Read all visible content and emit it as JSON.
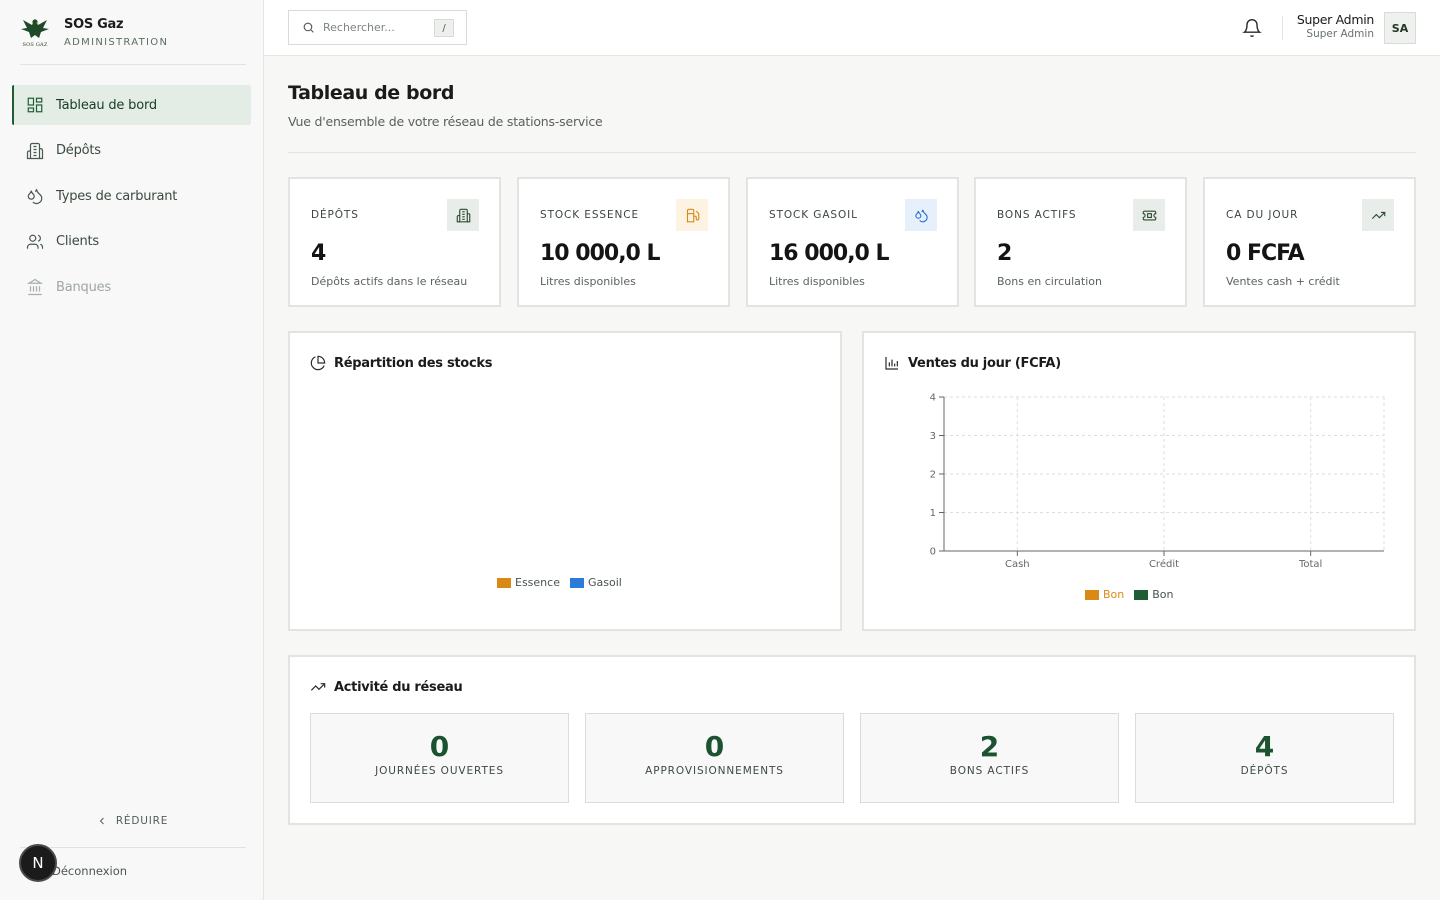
{
  "sidebar": {
    "brand_name": "SOS Gaz",
    "brand_subtitle": "ADMINISTRATION",
    "logo_caption": "SOS GAZ",
    "items": [
      {
        "label": "Tableau de bord",
        "icon": "dashboard-icon",
        "active": true
      },
      {
        "label": "Dépôts",
        "icon": "building-icon"
      },
      {
        "label": "Types de carburant",
        "icon": "droplets-icon"
      },
      {
        "label": "Clients",
        "icon": "users-icon"
      },
      {
        "label": "Banques",
        "icon": "bank-icon",
        "disabled": true
      }
    ],
    "reduce_label": "RÉDUIRE",
    "logout_label": "Déconnexion",
    "badge_letter": "N"
  },
  "header": {
    "search_placeholder": "Rechercher...",
    "search_shortcut": "/",
    "user_name": "Super Admin",
    "user_role": "Super Admin",
    "avatar_initials": "SA"
  },
  "page": {
    "title": "Tableau de bord",
    "subtitle": "Vue d'ensemble de votre réseau de stations-service"
  },
  "stats": [
    {
      "label": "DÉPÔTS",
      "value": "4",
      "desc": "Dépôts actifs dans le réseau",
      "icon": "building-icon",
      "icon_bg": "#e9edea",
      "icon_color": "#2d4a35"
    },
    {
      "label": "STOCK ESSENCE",
      "value": "10 000,0 L",
      "desc": "Litres disponibles",
      "icon": "fuel-pump-icon",
      "icon_bg": "#fdf3e3",
      "icon_color": "#d98a16"
    },
    {
      "label": "STOCK GASOIL",
      "value": "16 000,0 L",
      "desc": "Litres disponibles",
      "icon": "droplets-icon",
      "icon_bg": "#e6f0fb",
      "icon_color": "#2b6fcf"
    },
    {
      "label": "BONS ACTIFS",
      "value": "2",
      "desc": "Bons en circulation",
      "icon": "ticket-icon",
      "icon_bg": "#e9edea",
      "icon_color": "#2d4a35"
    },
    {
      "label": "CA DU JOUR",
      "value": "0 FCFA",
      "desc": "Ventes cash + crédit",
      "icon": "trending-up-icon",
      "icon_bg": "#e9edea",
      "icon_color": "#2d4a35"
    }
  ],
  "stock_chart": {
    "title": "Répartition des stocks",
    "legend": [
      {
        "name": "Essence",
        "color": "#d98a16"
      },
      {
        "name": "Gasoil",
        "color": "#2b7bd8"
      }
    ]
  },
  "chart_data": {
    "type": "bar",
    "title": "Ventes du jour (FCFA)",
    "categories": [
      "Cash",
      "Crédit",
      "Total"
    ],
    "series": [
      {
        "name": "Bon",
        "color": "#d98a16",
        "values": [
          0,
          0,
          0
        ]
      },
      {
        "name": "Bon",
        "color": "#1b5e34",
        "values": [
          0,
          0,
          0
        ]
      }
    ],
    "ylim": [
      0,
      4
    ],
    "yticks": [
      "0",
      "1",
      "2",
      "3",
      "4"
    ],
    "grid": true,
    "legend_position": "bottom"
  },
  "activity": {
    "title": "Activité du réseau",
    "items": [
      {
        "value": "0",
        "label": "JOURNÉES OUVERTES"
      },
      {
        "value": "0",
        "label": "APPROVISIONNEMENTS"
      },
      {
        "value": "2",
        "label": "BONS ACTIFS"
      },
      {
        "value": "4",
        "label": "DÉPÔTS"
      }
    ]
  }
}
